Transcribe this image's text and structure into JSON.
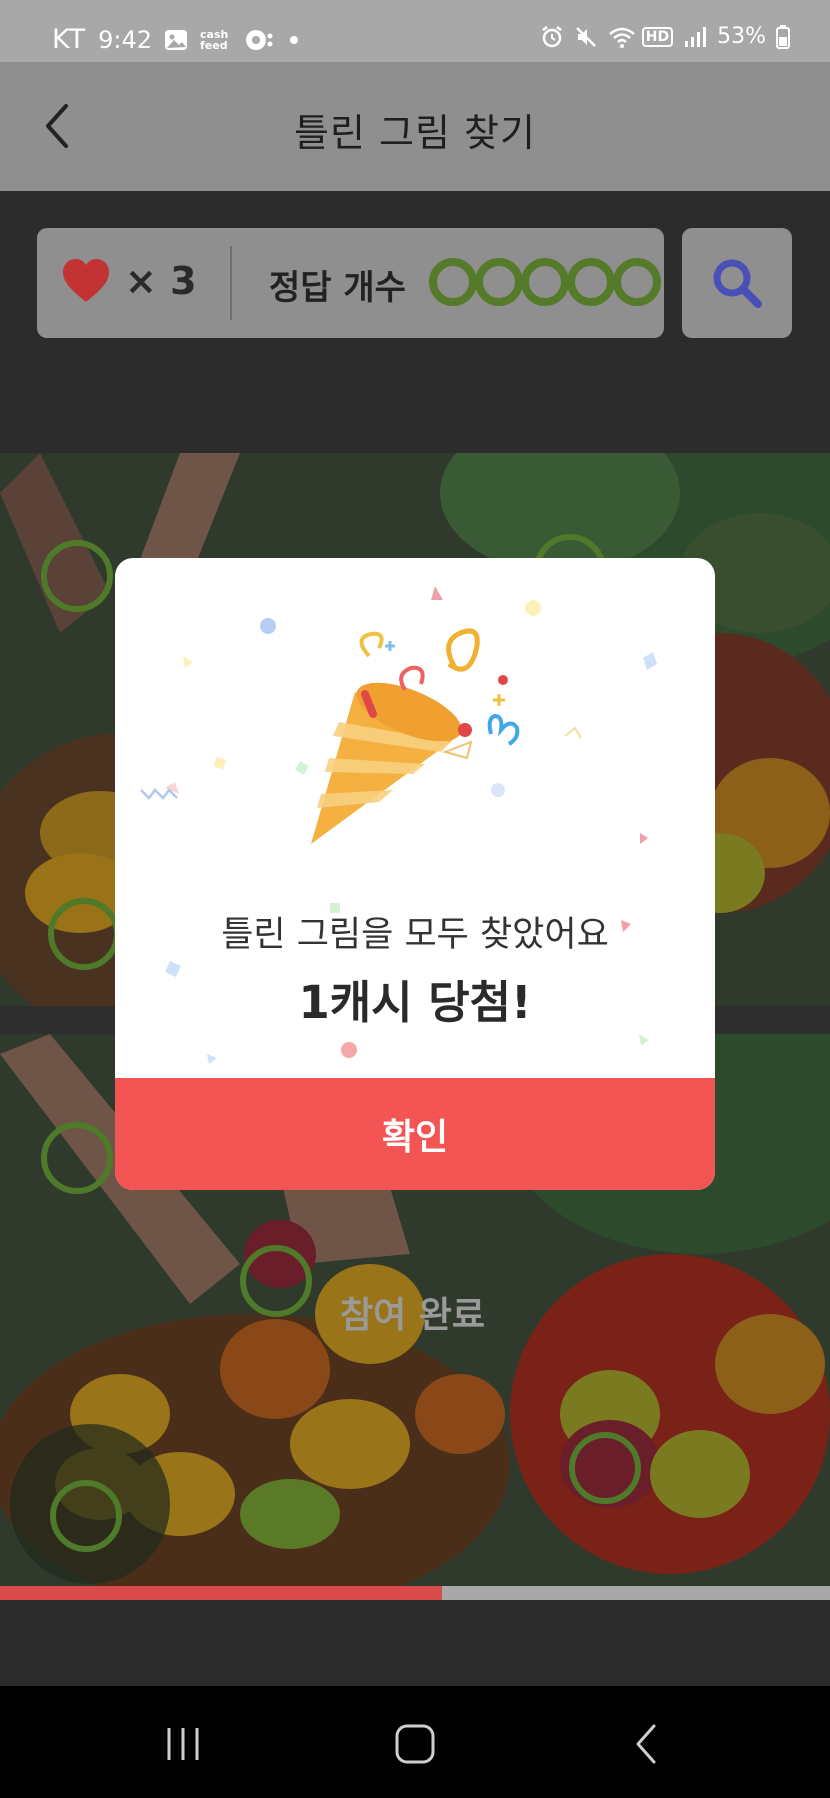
{
  "status_bar": {
    "carrier": "KT",
    "time": "9:42",
    "cashfeed_label": "cash feed",
    "network": "HD",
    "battery": "53%"
  },
  "header": {
    "title": "틀린 그림 찾기"
  },
  "score_panel": {
    "lives_text": "× 3",
    "answer_label": "정답 개수",
    "answers_found": 5,
    "answers_total": 5
  },
  "game": {
    "done_label": "참여 완료",
    "progress_fraction": 0.533
  },
  "modal": {
    "message": "틀린 그림을 모두 찾았어요",
    "prize": "1캐시 당첨!",
    "confirm_label": "확인"
  },
  "colors": {
    "accent": "#f25553",
    "found_circle": "#557a2a",
    "hint_icon": "#4a4fb8",
    "progress": "#d94a4a"
  },
  "icons": [
    "back-icon",
    "heart-icon",
    "search-icon",
    "party-popper-icon",
    "recent-apps-icon",
    "home-icon",
    "nav-back-icon"
  ]
}
